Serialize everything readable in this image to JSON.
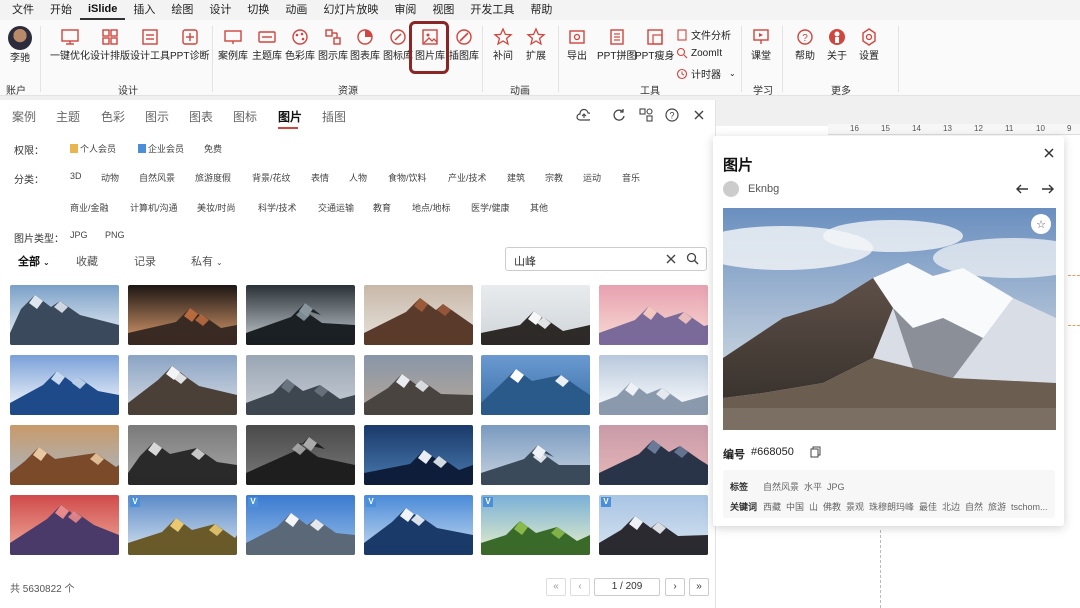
{
  "menu": [
    "文件",
    "开始",
    "iSlide",
    "插入",
    "绘图",
    "设计",
    "切换",
    "动画",
    "幻灯片放映",
    "审阅",
    "视图",
    "开发工具",
    "帮助"
  ],
  "menu_active_index": 2,
  "ribbon": {
    "user_name": "李驰",
    "account_group": "账户",
    "design_group": "设计",
    "resources_group": "资源",
    "animation_group": "动画",
    "tools_group": "工具",
    "learn_group": "学习",
    "more_group": "更多",
    "buttons": {
      "one_key": "一键优化",
      "design_layout": "设计排版",
      "design_tools": "设计工具",
      "ppt_diagnose": "PPT诊断",
      "case_lib": "案例库",
      "theme_lib": "主题库",
      "color_lib": "色彩库",
      "diagram_lib": "图示库",
      "chart_lib": "图表库",
      "icon_lib": "图标库",
      "image_lib": "图片库",
      "illus_lib": "插图库",
      "tween": "补间",
      "expand": "扩展",
      "export": "导出",
      "ppt_merge": "PPT拼图",
      "ppt_slim": "PPT瘦身",
      "file_analysis": "文件分析",
      "zoomit": "ZoomIt",
      "timer": "计时器",
      "course": "课堂",
      "help": "帮助",
      "about": "关于",
      "settings": "设置"
    }
  },
  "ruler": [
    "16",
    "15",
    "14",
    "13",
    "12",
    "11",
    "10",
    "9"
  ],
  "panel": {
    "tabs": [
      "案例",
      "主题",
      "色彩",
      "图示",
      "图表",
      "图标",
      "图片",
      "插图"
    ],
    "active_tab_index": 6,
    "permission_label": "权限：",
    "permissions": [
      "个人会员",
      "企业会员",
      "免费"
    ],
    "category_label": "分类：",
    "categories_row1": [
      "3D",
      "动物",
      "自然风景",
      "旅游度假",
      "背景/花纹",
      "表情",
      "人物",
      "食物/饮料",
      "产业/技术",
      "建筑",
      "宗教",
      "运动",
      "音乐"
    ],
    "categories_row2": [
      "商业/金融",
      "计算机/沟通",
      "美妆/时尚",
      "科学/技术",
      "交通运输",
      "教育",
      "地点/地标",
      "医学/健康",
      "其他"
    ],
    "type_label": "图片类型：",
    "types": [
      "JPG",
      "PNG"
    ],
    "subtabs": [
      "全部",
      "收藏",
      "记录",
      "私有"
    ],
    "search_value": "山峰",
    "total": "共 5630822 个",
    "page": "1 / 209"
  },
  "gallery": {
    "images": [
      {
        "tone": "mtn-blue",
        "vip": false
      },
      {
        "tone": "volcano",
        "vip": false
      },
      {
        "tone": "glacier-dark",
        "vip": false
      },
      {
        "tone": "rust",
        "vip": false
      },
      {
        "tone": "snow-forest",
        "vip": false
      },
      {
        "tone": "sunset-pink",
        "vip": false
      },
      {
        "tone": "blue-range",
        "vip": false
      },
      {
        "tone": "everest",
        "vip": false
      },
      {
        "tone": "grey-range",
        "vip": false
      },
      {
        "tone": "matterhorn",
        "vip": false
      },
      {
        "tone": "fuji",
        "vip": false
      },
      {
        "tone": "snowfield",
        "vip": false
      },
      {
        "tone": "hoodoos",
        "vip": false
      },
      {
        "tone": "bw-peak",
        "vip": false
      },
      {
        "tone": "bw-mist",
        "vip": false
      },
      {
        "tone": "lake-night",
        "vip": false
      },
      {
        "tone": "alps",
        "vip": false
      },
      {
        "tone": "dusk-layers",
        "vip": false
      },
      {
        "tone": "red-sky",
        "vip": false
      },
      {
        "tone": "golden-valley",
        "vip": true
      },
      {
        "tone": "snow-peak-blue",
        "vip": true
      },
      {
        "tone": "cloud-sea",
        "vip": true
      },
      {
        "tone": "green-valley",
        "vip": true
      },
      {
        "tone": "hiker",
        "vip": true
      }
    ]
  },
  "detail": {
    "title": "图片",
    "author": "Eknbg",
    "id_label": "编号",
    "id_value": "#668050",
    "tags_label": "标签",
    "tags": "自然风景  水平  JPG",
    "keywords_label": "关键词",
    "keywords": "西藏  中国  山  佛教  景观  珠穆朗玛峰  最佳  北边  自然  旅游  tschom..."
  },
  "colors": {
    "accent": "#d0453d",
    "highlight": "#8b2626",
    "vip": "#4a8fd8"
  }
}
